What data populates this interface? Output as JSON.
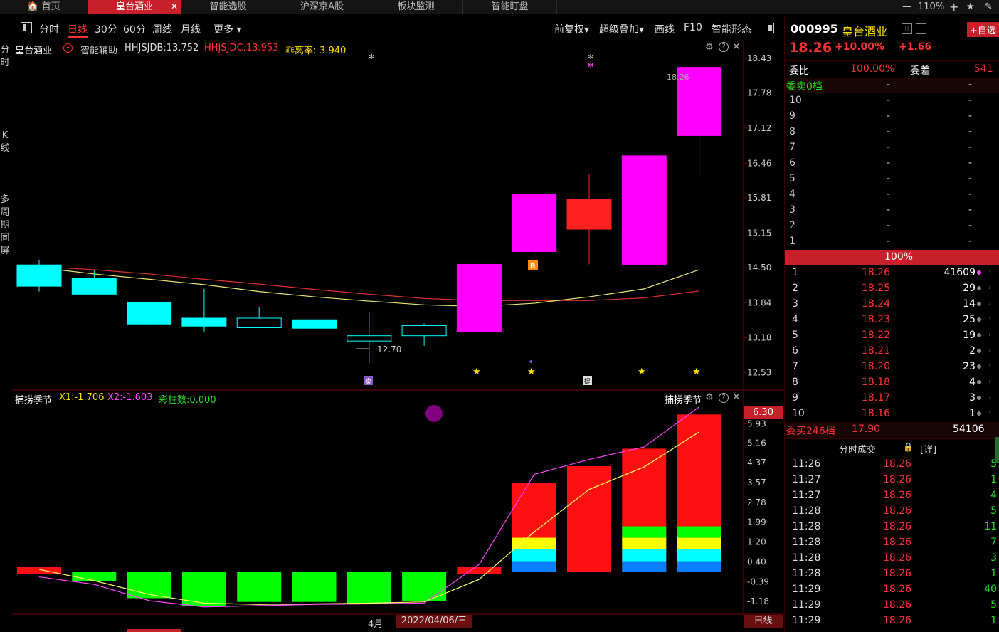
{
  "tabs": [
    {
      "label": "🏠 首页"
    },
    {
      "label": "皇台酒业",
      "active": true
    },
    {
      "label": "智能选股"
    },
    {
      "label": "沪深京A股"
    },
    {
      "label": "板块监测"
    },
    {
      "label": "智能盯盘"
    }
  ],
  "window": {
    "zoom": "110%",
    "minimize": "—",
    "plus": "+",
    "star": "★",
    "pin": "✎"
  },
  "side_labels": {
    "fenshi": "分时",
    "kxian": "K线",
    "multi": "多周期同屏"
  },
  "toolbar": {
    "items": [
      "分时",
      "日线",
      "30分",
      "60分",
      "周线",
      "月线",
      "更多 ▾"
    ],
    "selected": "日线",
    "right": [
      "前复权▾",
      "超级叠加▾",
      "画线",
      "F10",
      "智能形态"
    ]
  },
  "main_panel": {
    "stock_name": "皇台酒业",
    "assist": "智能辅助",
    "hhjsjdb": "HHJSJDB:13.752",
    "hhjsjdc": "HHJSJDC:13.953",
    "deviation": "乖离率:-3.940",
    "high_label": "18.26",
    "low_label": "12.70",
    "price_axis": [
      "18.43",
      "17.78",
      "17.12",
      "16.46",
      "15.81",
      "15.15",
      "14.50",
      "13.84",
      "13.18",
      "12.53"
    ],
    "markers": [
      "卖",
      "B",
      "提"
    ]
  },
  "sub_panel": {
    "title": "捕捞季节",
    "x1": "X1:-1.706",
    "x2": "X2:-1.603",
    "caizhu": "彩柱数:0.000",
    "title_right": "捕捞季节",
    "current_value": "6.30",
    "axis": [
      "5.93",
      "5.16",
      "4.37",
      "3.57",
      "2.78",
      "1.99",
      "1.20",
      "0.40",
      "-0.39",
      "-1.18"
    ]
  },
  "bottom_bar": {
    "month": "4月",
    "date": "2022/04/06/三",
    "period": "日线"
  },
  "chart_data": {
    "type": "candlestick",
    "candles": [
      {
        "open": 14.15,
        "high": 14.65,
        "low": 14.05,
        "close": 14.55,
        "color": "cyan"
      },
      {
        "open": 14.3,
        "high": 14.45,
        "low": 14.0,
        "close": 14.0,
        "color": "cyan"
      },
      {
        "open": 13.84,
        "high": 13.84,
        "low": 13.4,
        "close": 13.44,
        "color": "cyan"
      },
      {
        "open": 13.4,
        "high": 14.1,
        "low": 13.3,
        "close": 13.55,
        "color": "cyan-down"
      },
      {
        "open": 13.55,
        "high": 13.75,
        "low": 13.37,
        "close": 13.37,
        "color": "cyan-hollow"
      },
      {
        "open": 13.52,
        "high": 13.66,
        "low": 13.26,
        "close": 13.36,
        "color": "cyan"
      },
      {
        "open": 13.12,
        "high": 13.66,
        "low": 12.7,
        "close": 13.22,
        "color": "cyan-hollow"
      },
      {
        "open": 13.22,
        "high": 13.45,
        "low": 13.03,
        "close": 13.41,
        "color": "cyan-hollow"
      },
      {
        "open": 13.3,
        "high": 14.56,
        "low": 13.3,
        "close": 14.56,
        "color": "magenta"
      },
      {
        "open": 14.8,
        "high": 15.87,
        "low": 14.72,
        "close": 15.87,
        "color": "magenta"
      },
      {
        "open": 15.22,
        "high": 16.25,
        "low": 14.56,
        "close": 15.78,
        "color": "red"
      },
      {
        "open": 14.56,
        "high": 16.6,
        "low": 14.56,
        "close": 16.6,
        "color": "magenta"
      },
      {
        "open": 16.98,
        "high": 18.26,
        "low": 16.2,
        "close": 18.26,
        "color": "magenta"
      }
    ],
    "ma_yellow": [
      14.5,
      14.38,
      14.28,
      14.18,
      14.05,
      13.95,
      13.87,
      13.8,
      13.77,
      13.83,
      13.95,
      14.1,
      14.46
    ],
    "ma_red": [
      14.52,
      14.46,
      14.38,
      14.28,
      14.19,
      14.09,
      14.0,
      13.92,
      13.88,
      13.88,
      13.88,
      13.93,
      14.06
    ],
    "macd_bars": [
      0.2,
      -0.38,
      -1.05,
      -1.35,
      -1.2,
      -1.2,
      -1.28,
      -1.15,
      0.2,
      3.57,
      4.23,
      4.93,
      6.3
    ],
    "x1_line": [
      0.1,
      -0.35,
      -0.9,
      -1.25,
      -1.3,
      -1.28,
      -1.25,
      -1.2,
      -0.3,
      1.6,
      3.3,
      4.2,
      5.6
    ],
    "x2_line": [
      -0.2,
      -0.5,
      -1.15,
      -1.4,
      -1.35,
      -1.3,
      -1.28,
      -1.25,
      0.3,
      3.9,
      4.5,
      5.0,
      6.6
    ]
  },
  "quote": {
    "code": "000995",
    "name": "皇台酒业",
    "add_btn": "+自选",
    "price": "18.26",
    "pct": "+10.00%",
    "chg": "+1.66",
    "weibi_label": "委比",
    "weibi": "100.00%",
    "weicha_label": "委差",
    "weicha": "541",
    "sell_head": "委卖0档",
    "dash": "-",
    "sell_levels": [
      "10",
      "9",
      "8",
      "7",
      "6",
      "5",
      "4",
      "3",
      "2",
      "1"
    ],
    "ratio": "100%",
    "buy_levels": [
      {
        "n": "1",
        "p": "18.26",
        "v": "41609"
      },
      {
        "n": "2",
        "p": "18.25",
        "v": "29"
      },
      {
        "n": "3",
        "p": "18.24",
        "v": "14"
      },
      {
        "n": "4",
        "p": "18.23",
        "v": "25"
      },
      {
        "n": "5",
        "p": "18.22",
        "v": "19"
      },
      {
        "n": "6",
        "p": "18.21",
        "v": "2"
      },
      {
        "n": "7",
        "p": "18.20",
        "v": "23"
      },
      {
        "n": "8",
        "p": "18.18",
        "v": "4"
      },
      {
        "n": "9",
        "p": "18.17",
        "v": "3"
      },
      {
        "n": "10",
        "p": "18.16",
        "v": "1"
      }
    ],
    "buy_head": "委买246档",
    "buy_price": "17.90",
    "buy_vol": "54106",
    "trades_title": "分时成交",
    "trades_detail": "[详]",
    "trades": [
      {
        "t": "11:26",
        "p": "18.26",
        "v": "5"
      },
      {
        "t": "11:27",
        "p": "18.26",
        "v": "1"
      },
      {
        "t": "11:27",
        "p": "18.26",
        "v": "4"
      },
      {
        "t": "11:28",
        "p": "18.26",
        "v": "5"
      },
      {
        "t": "11:28",
        "p": "18.26",
        "v": "11"
      },
      {
        "t": "11:28",
        "p": "18.26",
        "v": "7"
      },
      {
        "t": "11:28",
        "p": "18.26",
        "v": "3"
      },
      {
        "t": "11:28",
        "p": "18.26",
        "v": "1"
      },
      {
        "t": "11:29",
        "p": "18.26",
        "v": "40"
      },
      {
        "t": "11:29",
        "p": "18.26",
        "v": "5"
      },
      {
        "t": "11:29",
        "p": "18.26",
        "v": "1"
      }
    ]
  }
}
